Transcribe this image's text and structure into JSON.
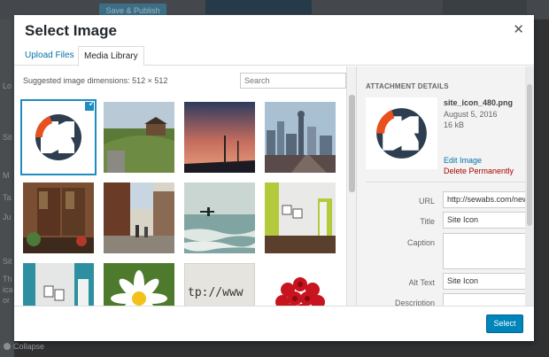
{
  "backdrop": {
    "save_label": "Save & Publish",
    "side_text": [
      "Lo",
      "Sit",
      "M",
      "Ta",
      "Ju",
      "Sit",
      "Th",
      "ica",
      "or"
    ],
    "collapse_label": "Collapse"
  },
  "modal": {
    "title": "Select Image",
    "close_icon": "close-icon"
  },
  "tabs": [
    {
      "label": "Upload Files",
      "active": false
    },
    {
      "label": "Media Library",
      "active": true
    }
  ],
  "browser": {
    "suggested_text": "Suggested image dimensions: 512 × 512",
    "search_placeholder": "Search"
  },
  "thumbnails": [
    {
      "name": "site-icon",
      "selected": true
    },
    {
      "name": "grassy-hill-hut",
      "selected": false
    },
    {
      "name": "sunset-sky",
      "selected": false
    },
    {
      "name": "city-skyline",
      "selected": false
    },
    {
      "name": "wooden-doors-room",
      "selected": false
    },
    {
      "name": "village-street",
      "selected": false
    },
    {
      "name": "beach-surfer",
      "selected": false
    },
    {
      "name": "green-room-frame",
      "selected": false
    },
    {
      "name": "teal-wall-frame",
      "selected": false
    },
    {
      "name": "daisy-flower",
      "selected": false
    },
    {
      "name": "typewriter-http",
      "selected": false,
      "text": "tp://www"
    },
    {
      "name": "red-roses",
      "selected": false
    }
  ],
  "attachment_details": {
    "heading": "ATTACHMENT DETAILS",
    "filename": "site_icon_480.png",
    "date": "August 5, 2016",
    "size": "16 kB",
    "edit_link": "Edit Image",
    "delete_link": "Delete Permanently",
    "fields": [
      {
        "label": "URL",
        "value": "http://sewabs.com/new/w"
      },
      {
        "label": "Title",
        "value": "Site Icon"
      },
      {
        "label": "Caption",
        "value": ""
      },
      {
        "label": "Alt Text",
        "value": "Site Icon"
      },
      {
        "label": "Description",
        "value": ""
      }
    ]
  },
  "toolbar": {
    "select_label": "Select"
  },
  "colors": {
    "accent": "#0085ba",
    "link": "#0073aa",
    "delete": "#aa0000",
    "icon_dark": "#2c3e50",
    "icon_orange": "#e8501e"
  }
}
